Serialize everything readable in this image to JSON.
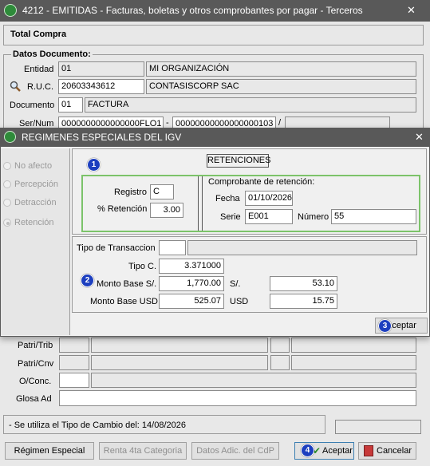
{
  "main_window": {
    "title": "4212 - EMITIDAS - Facturas, boletas y otros comprobantes por pagar - Terceros",
    "close_glyph": "✕",
    "total_compra_label": "Total Compra",
    "datos_documento_label": "Datos Documento:",
    "entidad_label": "Entidad",
    "entidad_code": "01",
    "entidad_name": "MI ORGANIZACIÓN",
    "ruc_label": "R.U.C.",
    "ruc_value": "20603343612",
    "ruc_name": "CONTASISCORP SAC",
    "documento_label": "Documento",
    "documento_code": "01",
    "documento_name": "FACTURA",
    "sernum_label": "Ser/Num",
    "serie_value": "0000000000000000FLO1",
    "dash": "-",
    "numero_value": "00000000000000000103",
    "slash": "/",
    "patri_trib_label": "Patri/Trib",
    "patri_cnv_label": "Patri/Cnv",
    "oconc_label": "O/Conc.",
    "glosa_label": "Glosa Ad",
    "status_text": "- Se utiliza el Tipo de Cambio del: 14/08/2026",
    "btn_regimen": "Régimen Especial",
    "btn_renta": "Renta 4ta Categoria",
    "btn_datos_adic": "Datos Adic. del CdP",
    "btn_aceptar": "Aceptar",
    "btn_cancelar": "Cancelar"
  },
  "dialog": {
    "title": "REGIMENES ESPECIALES DEL IGV",
    "close_glyph": "✕",
    "options": [
      "No afecto",
      "Percepción",
      "Detracción",
      "Retención"
    ],
    "selected_option": "Retención",
    "section_title": "RETENCIONES",
    "registro_label": "Registro",
    "registro_value": "C",
    "pct_retencion_label": "% Retención",
    "pct_retencion_value": "3.00",
    "comprobante_label": "Comprobante de retención:",
    "fecha_label": "Fecha",
    "fecha_value": "01/10/2026",
    "serie_label": "Serie",
    "serie_value": "E001",
    "numero_label": "Número",
    "numero_value": "55",
    "tipo_transaccion_label": "Tipo de Transaccion",
    "tipo_c_label": "Tipo C.",
    "tipo_c_value": "3.371000",
    "monto_base_soles_label": "Monto Base S/.",
    "monto_base_soles_value": "1,770.00",
    "soles_label": "S/.",
    "soles_value": "53.10",
    "monto_base_usd_label": "Monto Base USD",
    "monto_base_usd_value": "525.07",
    "usd_label": "USD",
    "usd_value": "15.75",
    "btn_aceptar": "Aceptar"
  },
  "badges": [
    "1",
    "2",
    "3",
    "4"
  ],
  "colors": {
    "title_bar": "#595959",
    "highlight_green": "#7cc36a",
    "badge_blue": "#1d3fbf"
  }
}
